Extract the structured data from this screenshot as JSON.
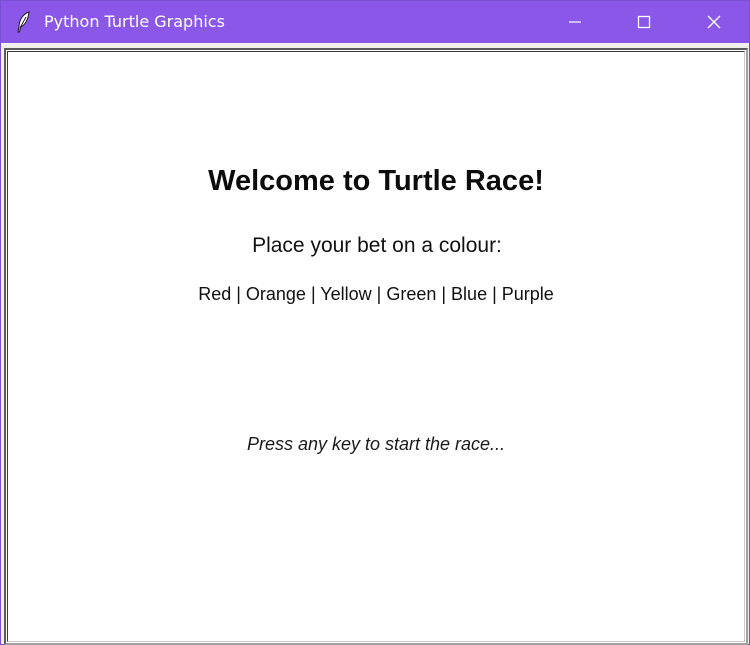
{
  "window": {
    "title": "Python Turtle Graphics",
    "icons": {
      "app": "feather-icon",
      "minimize": "minimize-icon",
      "maximize": "maximize-icon",
      "close": "close-icon"
    },
    "colors": {
      "titlebar": "#8b57e8",
      "canvas": "#ffffff"
    }
  },
  "canvas": {
    "heading": "Welcome to Turtle Race!",
    "prompt": "Place your bet on a colour:",
    "colour_options": "Red | Orange | Yellow | Green | Blue | Purple",
    "start_hint": "Press any key to start the race..."
  }
}
